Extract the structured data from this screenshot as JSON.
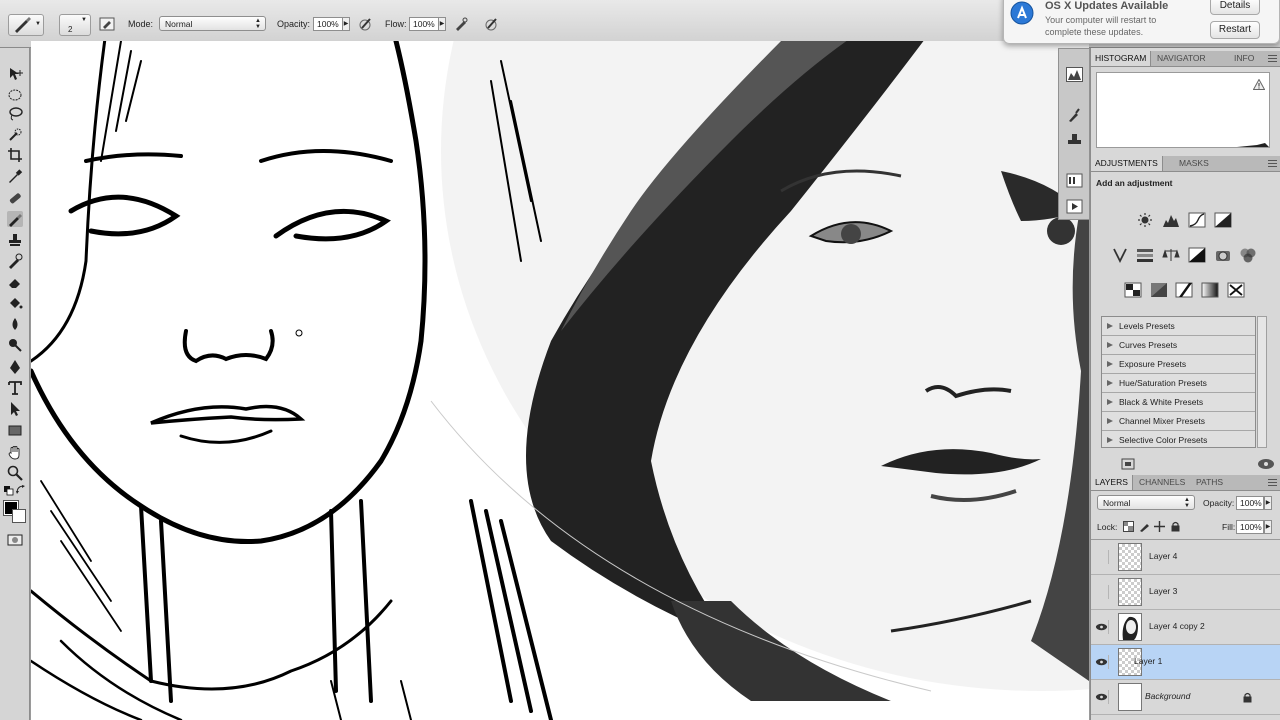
{
  "options_bar": {
    "brush_size": "2",
    "mode_label": "Mode:",
    "mode_value": "Normal",
    "opacity_label": "Opacity:",
    "opacity_value": "100%",
    "flow_label": "Flow:",
    "flow_value": "100%"
  },
  "notification": {
    "title": "OS X Updates Available",
    "body": "Your computer will restart to complete these updates.",
    "details_button": "Details",
    "restart_button": "Restart"
  },
  "histogram_panel": {
    "tabs": [
      "HISTOGRAM",
      "NAVIGATOR",
      "INFO"
    ]
  },
  "adjustments_panel": {
    "tabs": [
      "ADJUSTMENTS",
      "MASKS"
    ],
    "heading": "Add an adjustment",
    "presets": [
      "Levels Presets",
      "Curves Presets",
      "Exposure Presets",
      "Hue/Saturation Presets",
      "Black & White Presets",
      "Channel Mixer Presets",
      "Selective Color Presets"
    ]
  },
  "layers_panel": {
    "tabs": [
      "LAYERS",
      "CHANNELS",
      "PATHS"
    ],
    "blend_mode": "Normal",
    "opacity_label": "Opacity:",
    "opacity_value": "100%",
    "lock_label": "Lock:",
    "fill_label": "Fill:",
    "fill_value": "100%",
    "layers": [
      {
        "name": "Layer 4",
        "visible": false,
        "selected": false
      },
      {
        "name": "Layer 3",
        "visible": false,
        "selected": false
      },
      {
        "name": "Layer 4 copy 2",
        "visible": true,
        "selected": false
      },
      {
        "name": "Layer 1",
        "visible": true,
        "selected": true
      },
      {
        "name": "Background",
        "visible": true,
        "selected": false,
        "locked": true
      }
    ]
  },
  "colors": {
    "selected_layer": "#b8d4f5",
    "panel_bg": "#d8d8d8",
    "foreground_color": "#000000",
    "background_color": "#ffffff"
  }
}
